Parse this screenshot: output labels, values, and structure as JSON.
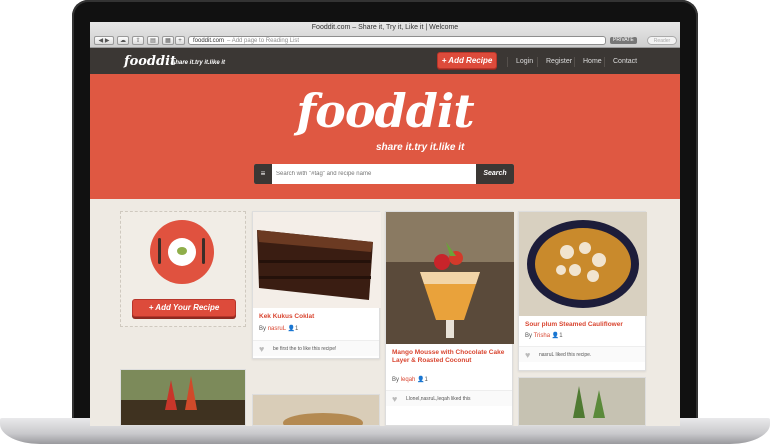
{
  "browser": {
    "window_title": "Fooddit.com – Share it, Try it, Like it | Welcome",
    "url": "fooddit.com",
    "url_hint": "– Add page to Reading List",
    "private_label": "PRIVATE",
    "reader_label": "Reader",
    "add_tab": "+"
  },
  "nav": {
    "logo": "fooddit",
    "tagline": "share it.try it.like it",
    "add_recipe": "+ Add Recipe",
    "links": [
      "Login",
      "Register",
      "Home",
      "Contact"
    ]
  },
  "hero": {
    "logo": "fooddit",
    "tagline": "share it.try it.like it",
    "search_placeholder": "Search with \"#tag\" and recipe name",
    "search_button": "Search",
    "list_icon": "≡"
  },
  "sidebar": {
    "add_recipe": "+ Add Your Recipe"
  },
  "colors": {
    "accent": "#df5842",
    "dark": "#3b3734",
    "link": "#d94631"
  },
  "cards": [
    {
      "title": "Kek Kukus Coklat",
      "by": "By",
      "author": "nasruL",
      "count": "1",
      "like_text": "be first the to like this recipe!"
    },
    {
      "title": "Mango Mousse with Chocolate Cake Layer & Roasted Coconut",
      "by": "By",
      "author": "leqah",
      "count": "1",
      "like_text": "Llonel,nasruL,leqah liked this"
    },
    {
      "title": "Sour plum Steamed Cauliflower",
      "by": "By",
      "author": "Trisha",
      "count": "1",
      "like_text": "nasruL liked this recipe."
    }
  ]
}
